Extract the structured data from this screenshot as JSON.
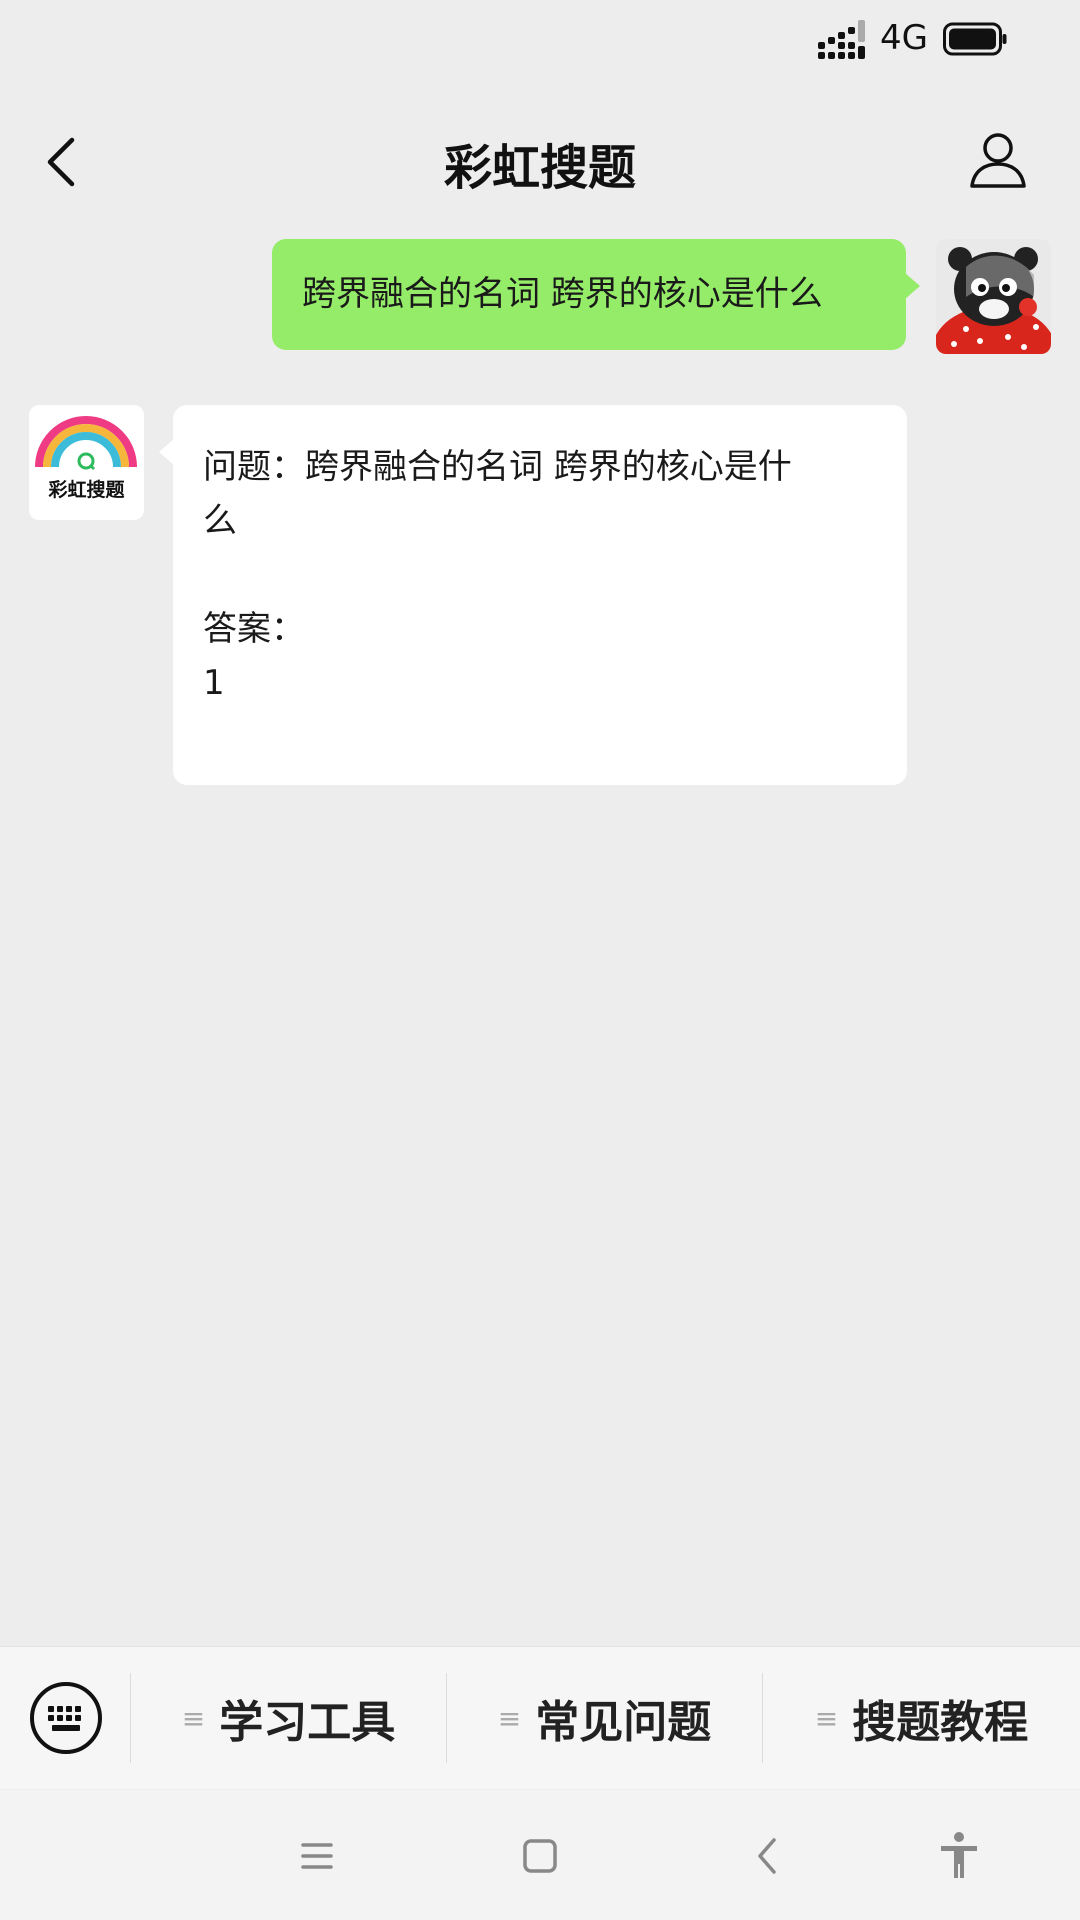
{
  "status_bar": {
    "network_type": "4G",
    "battery_icon": "battery-icon",
    "signal_icon": "signal-icon"
  },
  "header": {
    "title": "彩虹搜题",
    "back_icon": "chevron-left-icon",
    "profile_icon": "person-icon"
  },
  "messages": {
    "user": {
      "text": "跨界融合的名词  跨界的核心是什么"
    },
    "bot": {
      "avatar_label": "彩虹搜题",
      "lines": [
        "问题：跨界融合的名词  跨界的核心是什",
        "么",
        "",
        "答案：",
        "1"
      ]
    }
  },
  "menu": {
    "keyboard_icon": "keyboard-icon",
    "items": [
      {
        "label": "学习工具"
      },
      {
        "label": "常见问题"
      },
      {
        "label": "搜题教程"
      }
    ]
  },
  "system_nav": {
    "icons": [
      "menu-icon",
      "home-square-icon",
      "back-icon",
      "accessibility-icon"
    ]
  },
  "colors": {
    "user_bubble": "#95ec69",
    "background": "#ededed"
  }
}
